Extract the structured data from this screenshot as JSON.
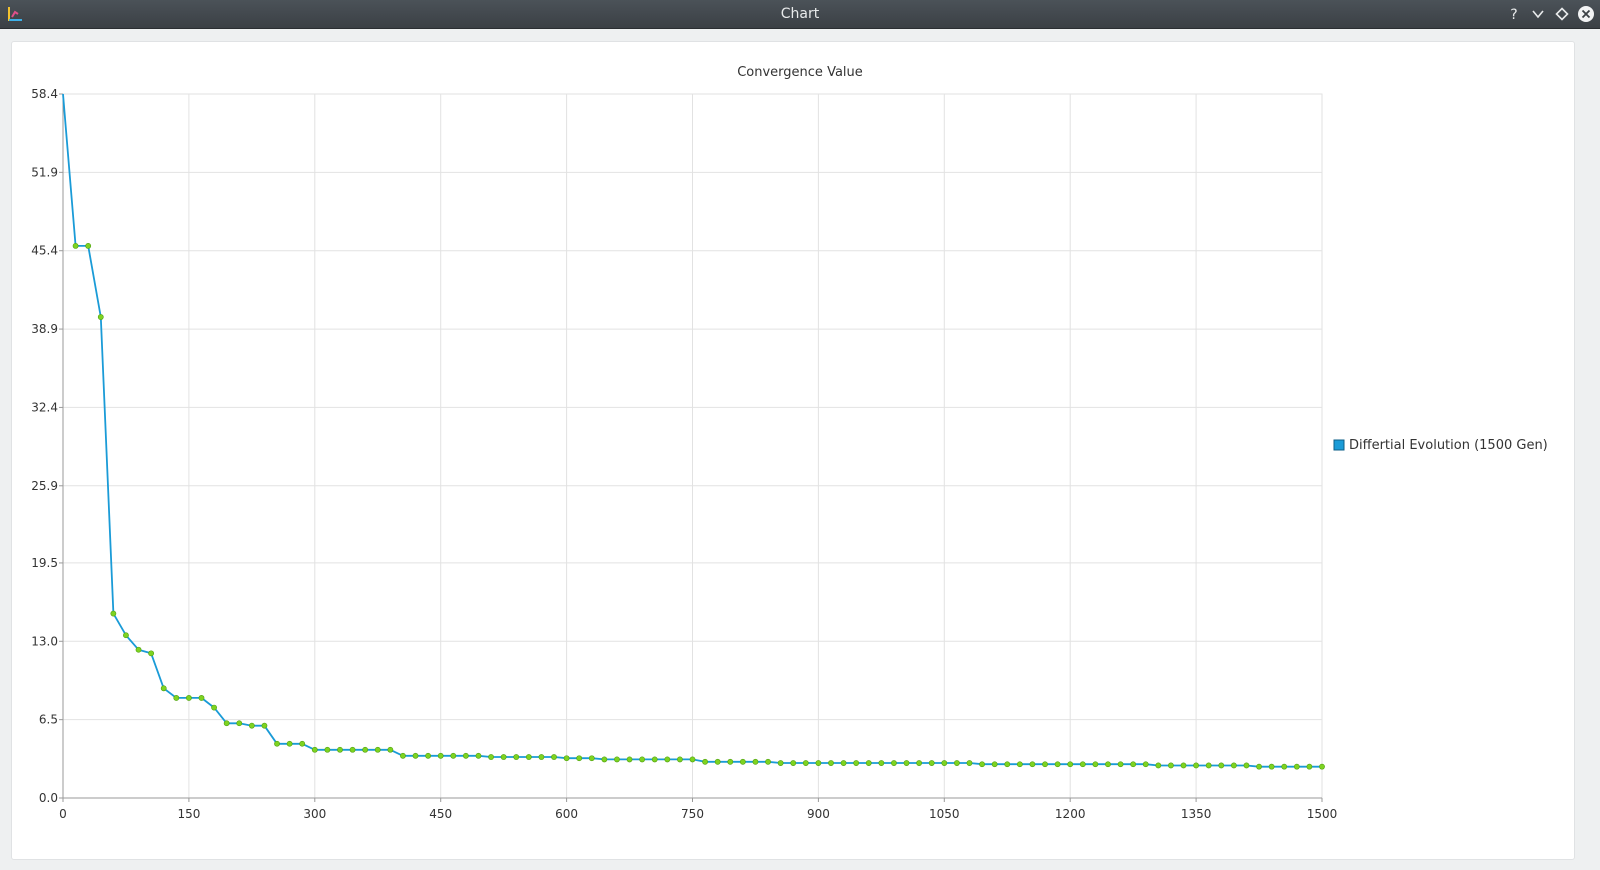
{
  "window": {
    "title": "Chart",
    "buttons": [
      "help-icon",
      "minimize-icon",
      "maximize-icon",
      "close-icon"
    ]
  },
  "colors": {
    "line": "#1a9bd7",
    "marker": "#7ed321",
    "marker_stroke": "#4ea10f",
    "grid": "#e2e2e2",
    "axis": "#9a9a9a"
  },
  "chart_data": {
    "type": "line",
    "title": "Convergence Value",
    "xlabel": "",
    "ylabel": "",
    "xlim": [
      0,
      1500
    ],
    "ylim": [
      0,
      58.4
    ],
    "x_ticks": [
      "0",
      "150",
      "300",
      "450",
      "600",
      "750",
      "900",
      "1050",
      "1200",
      "1350",
      "1500"
    ],
    "y_ticks": [
      "0.0",
      "6.5",
      "13.0",
      "19.5",
      "25.9",
      "32.4",
      "38.9",
      "45.4",
      "51.9",
      "58.4"
    ],
    "grid": true,
    "legend_position": "right",
    "series": [
      {
        "name": "Differtial Evolution (1500 Gen)",
        "x": [
          0,
          15,
          30,
          45,
          60,
          75,
          90,
          105,
          120,
          135,
          150,
          165,
          180,
          195,
          210,
          225,
          240,
          255,
          270,
          285,
          300,
          315,
          330,
          345,
          360,
          375,
          390,
          405,
          420,
          435,
          450,
          465,
          480,
          495,
          510,
          525,
          540,
          555,
          570,
          585,
          600,
          615,
          630,
          645,
          660,
          675,
          690,
          705,
          720,
          735,
          750,
          765,
          780,
          795,
          810,
          825,
          840,
          855,
          870,
          885,
          900,
          915,
          930,
          945,
          960,
          975,
          990,
          1005,
          1020,
          1035,
          1050,
          1065,
          1080,
          1095,
          1110,
          1125,
          1140,
          1155,
          1170,
          1185,
          1200,
          1215,
          1230,
          1245,
          1260,
          1275,
          1290,
          1305,
          1320,
          1335,
          1350,
          1365,
          1380,
          1395,
          1410,
          1425,
          1440,
          1455,
          1470,
          1485,
          1500
        ],
        "values": [
          58.4,
          45.8,
          45.8,
          39.9,
          15.3,
          13.5,
          12.3,
          12.0,
          9.1,
          8.3,
          8.3,
          8.3,
          7.5,
          6.2,
          6.2,
          6.0,
          6.0,
          4.5,
          4.5,
          4.5,
          4.0,
          4.0,
          4.0,
          4.0,
          4.0,
          4.0,
          4.0,
          3.5,
          3.5,
          3.5,
          3.5,
          3.5,
          3.5,
          3.5,
          3.4,
          3.4,
          3.4,
          3.4,
          3.4,
          3.4,
          3.3,
          3.3,
          3.3,
          3.2,
          3.2,
          3.2,
          3.2,
          3.2,
          3.2,
          3.2,
          3.2,
          3.0,
          3.0,
          3.0,
          3.0,
          3.0,
          3.0,
          2.9,
          2.9,
          2.9,
          2.9,
          2.9,
          2.9,
          2.9,
          2.9,
          2.9,
          2.9,
          2.9,
          2.9,
          2.9,
          2.9,
          2.9,
          2.9,
          2.8,
          2.8,
          2.8,
          2.8,
          2.8,
          2.8,
          2.8,
          2.8,
          2.8,
          2.8,
          2.8,
          2.8,
          2.8,
          2.8,
          2.7,
          2.7,
          2.7,
          2.7,
          2.7,
          2.7,
          2.7,
          2.7,
          2.6,
          2.6,
          2.6,
          2.6,
          2.6,
          2.6
        ]
      }
    ]
  }
}
